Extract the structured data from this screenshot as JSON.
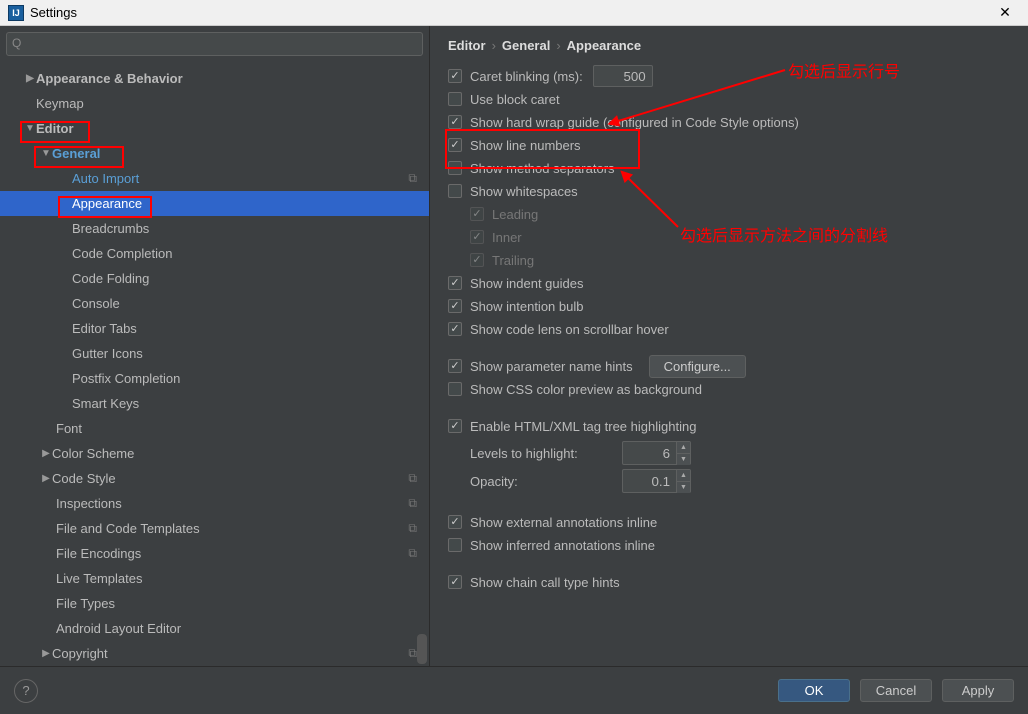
{
  "window": {
    "title": "Settings"
  },
  "search": {
    "placeholder": ""
  },
  "tree": {
    "appearance_behavior": "Appearance & Behavior",
    "keymap": "Keymap",
    "editor": "Editor",
    "general": "General",
    "auto_import": "Auto Import",
    "appearance": "Appearance",
    "breadcrumbs": "Breadcrumbs",
    "code_completion": "Code Completion",
    "code_folding": "Code Folding",
    "console": "Console",
    "editor_tabs": "Editor Tabs",
    "gutter_icons": "Gutter Icons",
    "postfix_completion": "Postfix Completion",
    "smart_keys": "Smart Keys",
    "font": "Font",
    "color_scheme": "Color Scheme",
    "code_style": "Code Style",
    "inspections": "Inspections",
    "file_code_templates": "File and Code Templates",
    "file_encodings": "File Encodings",
    "live_templates": "Live Templates",
    "file_types": "File Types",
    "android_layout_editor": "Android Layout Editor",
    "copyright": "Copyright"
  },
  "breadcrumb": {
    "p1": "Editor",
    "p2": "General",
    "p3": "Appearance"
  },
  "opts": {
    "caret_blinking": "Caret blinking (ms):",
    "caret_blinking_value": "500",
    "use_block_caret": "Use block caret",
    "show_hard_wrap": "Show hard wrap guide (configured in Code Style options)",
    "show_line_numbers": "Show line numbers",
    "show_method_separators": "Show method separators",
    "show_whitespaces": "Show whitespaces",
    "leading": "Leading",
    "inner": "Inner",
    "trailing": "Trailing",
    "show_indent_guides": "Show indent guides",
    "show_intention_bulb": "Show intention bulb",
    "show_code_lens": "Show code lens on scrollbar hover",
    "show_param_hints": "Show parameter name hints",
    "configure": "Configure...",
    "show_css_preview": "Show CSS color preview as background",
    "enable_html_xml": "Enable HTML/XML tag tree highlighting",
    "levels_to_highlight": "Levels to highlight:",
    "levels_value": "6",
    "opacity": "Opacity:",
    "opacity_value": "0.1",
    "show_external_ann": "Show external annotations inline",
    "show_inferred_ann": "Show inferred annotations inline",
    "show_chain_hints": "Show chain call type hints"
  },
  "annotations": {
    "line_numbers": "勾选后显示行号",
    "method_sep": "勾选后显示方法之间的分割线"
  },
  "buttons": {
    "ok": "OK",
    "cancel": "Cancel",
    "apply": "Apply"
  }
}
